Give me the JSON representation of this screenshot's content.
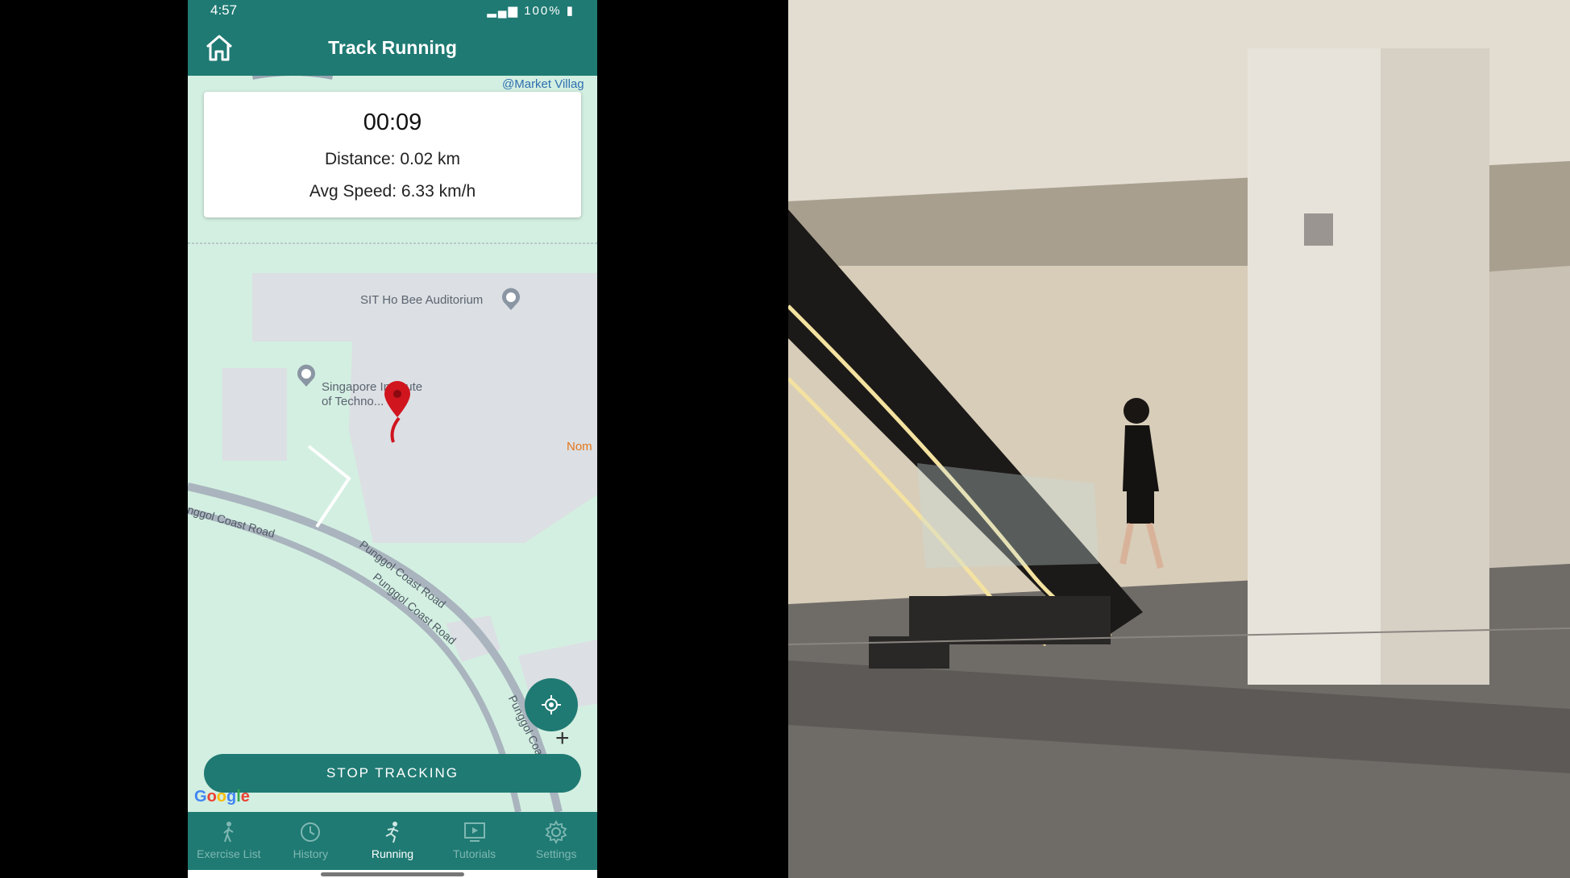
{
  "status_bar": {
    "time": "4:57",
    "battery": "100%"
  },
  "app_bar": {
    "title": "Track Running"
  },
  "stats": {
    "timer": "00:09",
    "distance": "Distance: 0.02 km",
    "avg_speed": "Avg Speed: 6.33 km/h"
  },
  "map": {
    "labels": {
      "market_village": "@Market Villag",
      "auditorium": "SIT Ho Bee Auditorium",
      "sit_line1": "Singapore Institute",
      "sit_line2": "of Techno...",
      "nom": "Nom",
      "road1": "nggol Coast Road",
      "road2": "Punggol Coast Road",
      "road3": "Punggol Coast Road",
      "road4": "Punggol Coa"
    },
    "zoom_in": "+",
    "attribution": [
      "G",
      "o",
      "o",
      "g",
      "l",
      "e"
    ]
  },
  "stop_button": {
    "label": "STOP TRACKING"
  },
  "bottom_nav": {
    "items": [
      {
        "label": "Exercise List",
        "icon": "person-walking-icon"
      },
      {
        "label": "History",
        "icon": "history-clock-icon"
      },
      {
        "label": "Running",
        "icon": "runner-icon"
      },
      {
        "label": "Tutorials",
        "icon": "tutorial-screen-icon"
      },
      {
        "label": "Settings",
        "icon": "gear-icon"
      }
    ],
    "active_index": 2
  },
  "colors": {
    "primary": "#1f7a73",
    "map_green": "#d3efe1",
    "route_red": "#d0151f"
  }
}
